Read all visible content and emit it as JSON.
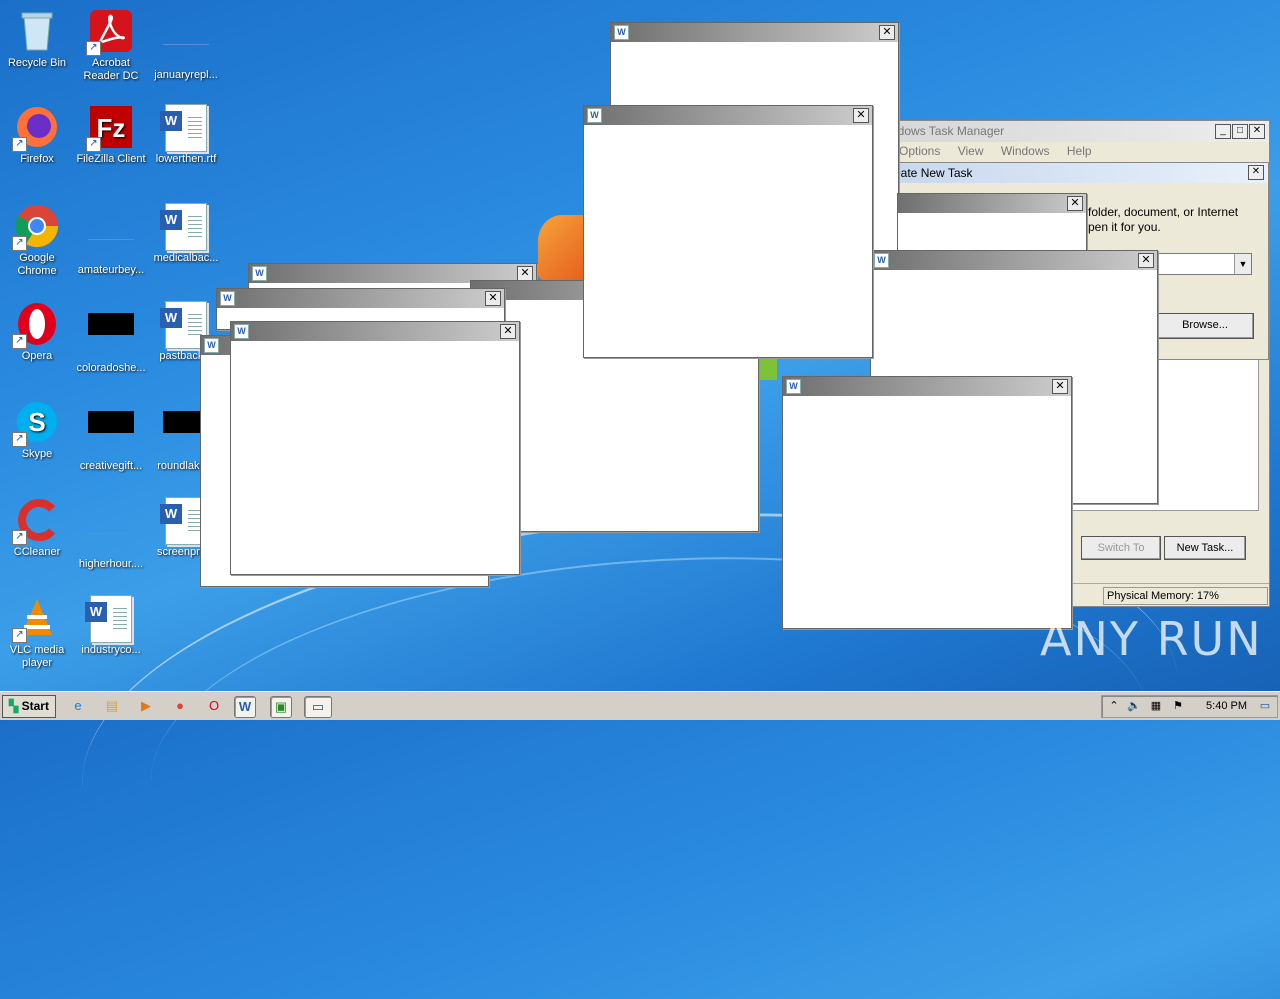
{
  "desktop": {
    "icons": [
      {
        "label": "Recycle Bin",
        "icon": "recycle-bin-icon"
      },
      {
        "label": "Acrobat Reader DC",
        "line1": "Acrobat",
        "line2": "Reader DC",
        "icon": "acrobat-icon"
      },
      {
        "label": "januaryrepl...",
        "icon": "file-icon"
      },
      {
        "label": "Firefox",
        "icon": "firefox-icon"
      },
      {
        "label": "FileZilla Client",
        "icon": "filezilla-icon"
      },
      {
        "label": "lowerthen.rtf",
        "icon": "word-doc-icon"
      },
      {
        "label": "Google Chrome",
        "line1": "Google",
        "line2": "Chrome",
        "icon": "chrome-icon"
      },
      {
        "label": "amateurbey...",
        "icon": "file-icon"
      },
      {
        "label": "medicalbac...",
        "icon": "word-doc-icon"
      },
      {
        "label": "Opera",
        "icon": "opera-icon"
      },
      {
        "label": "coloradoshe...",
        "icon": "black-thumbnail-icon"
      },
      {
        "label": "pastback...",
        "icon": "word-doc-icon"
      },
      {
        "label": "Skype",
        "icon": "skype-icon"
      },
      {
        "label": "creativegift...",
        "icon": "black-thumbnail-icon"
      },
      {
        "label": "roundlake...",
        "icon": "black-thumbnail-icon"
      },
      {
        "label": "CCleaner",
        "icon": "ccleaner-icon"
      },
      {
        "label": "higherhour....",
        "icon": "file-icon"
      },
      {
        "label": "screenpro...",
        "icon": "word-doc-icon"
      },
      {
        "label": "VLC media player",
        "line1": "VLC media",
        "line2": "player",
        "icon": "vlc-icon"
      },
      {
        "label": "industryco...",
        "icon": "word-doc-icon"
      }
    ]
  },
  "task_manager": {
    "title": "Windows Task Manager",
    "title_visible": "ndows Task Manager",
    "menu": [
      "Options",
      "View",
      "Windows",
      "Help"
    ],
    "switch_to": "Switch To",
    "new_task": "New Task...",
    "status_memory": "Physical Memory: 17%"
  },
  "create_new_task": {
    "title_visible": "eate New Task",
    "desc_line1": "folder, document, or Internet",
    "desc_line2": "pen it for you.",
    "browse": "Browse..."
  },
  "word_window": {
    "icon": "word-window-icon",
    "close": "✕"
  },
  "taskbar": {
    "start": "Start",
    "clock": "5:40 PM",
    "items": [
      "ie-icon",
      "explorer-icon",
      "media-player-icon",
      "chrome-icon",
      "opera-icon",
      "word-icon",
      "task-manager-icon",
      "run-dialog-icon"
    ]
  },
  "watermark": "ANY RUN"
}
